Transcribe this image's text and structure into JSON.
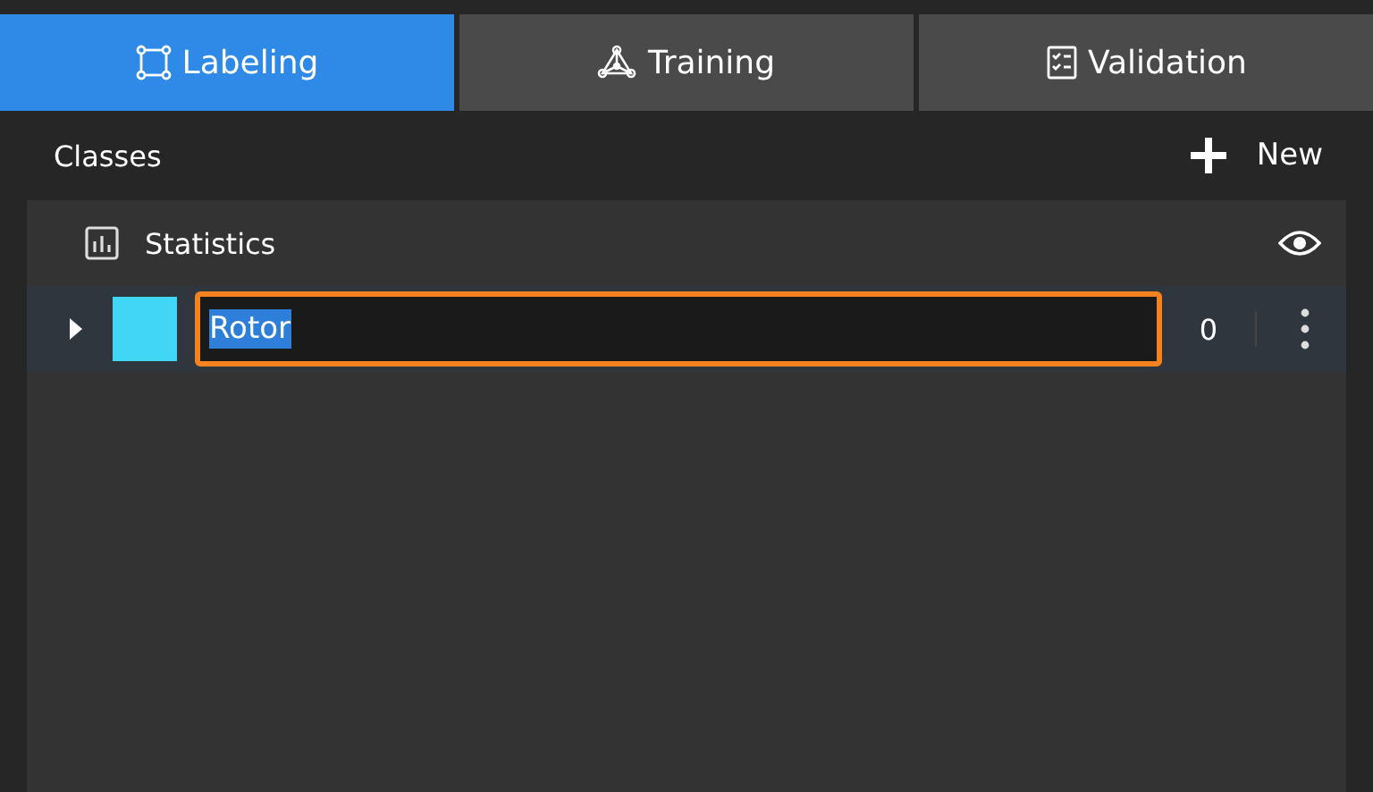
{
  "tabs": [
    {
      "label": "Labeling",
      "selected": true
    },
    {
      "label": "Training",
      "selected": false
    },
    {
      "label": "Validation",
      "selected": false
    }
  ],
  "header": {
    "title": "Classes",
    "new_button": "New"
  },
  "statistics": {
    "label": "Statistics"
  },
  "classes": [
    {
      "name": "Rotor",
      "color": "#41d6f5",
      "count": "0",
      "expanded": false,
      "editing": true
    }
  ]
}
